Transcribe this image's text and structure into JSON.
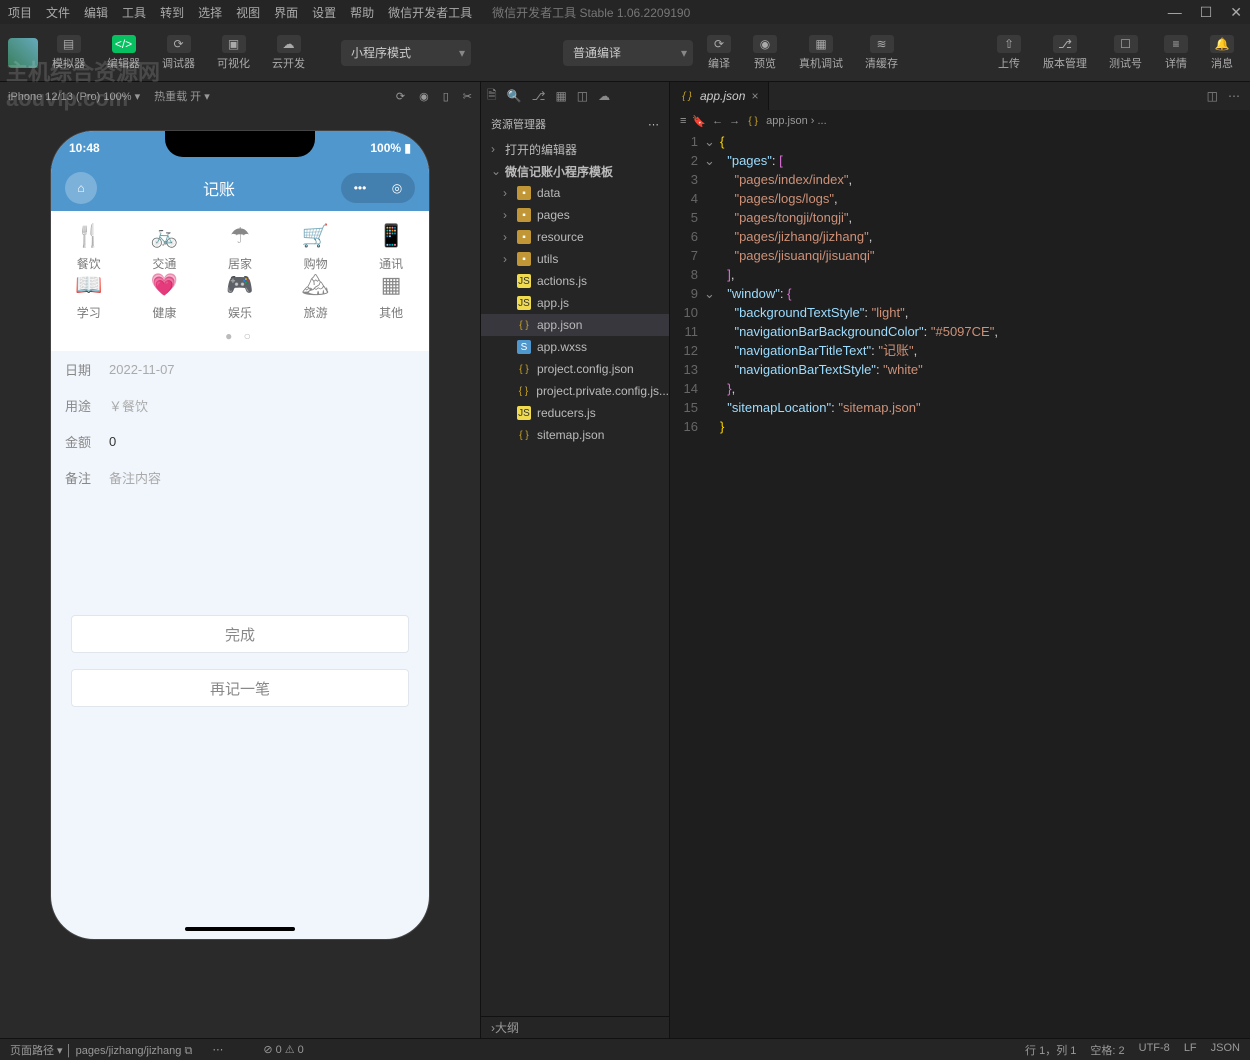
{
  "titlebar": {
    "menus": [
      "项目",
      "文件",
      "编辑",
      "工具",
      "转到",
      "选择",
      "视图",
      "界面",
      "设置",
      "帮助",
      "微信开发者工具"
    ],
    "app_title": "微信开发者工具 Stable 1.06.2209190"
  },
  "toolbar": {
    "buttons": [
      {
        "label": "模拟器",
        "id": "simulator-button"
      },
      {
        "label": "编辑器",
        "id": "editor-button"
      },
      {
        "label": "调试器",
        "id": "debugger-button"
      },
      {
        "label": "可视化",
        "id": "visual-button"
      },
      {
        "label": "云开发",
        "id": "cloud-button"
      }
    ],
    "mode": "小程序模式",
    "compile": "普通编译",
    "center": [
      {
        "label": "编译",
        "id": "compile-button"
      },
      {
        "label": "预览",
        "id": "preview-button"
      },
      {
        "label": "真机调试",
        "id": "remote-debug-button"
      },
      {
        "label": "清缓存",
        "id": "clear-cache-button"
      }
    ],
    "right": [
      {
        "label": "上传",
        "id": "upload-button"
      },
      {
        "label": "版本管理",
        "id": "version-button"
      },
      {
        "label": "测试号",
        "id": "test-button"
      },
      {
        "label": "详情",
        "id": "detail-button"
      },
      {
        "label": "消息",
        "id": "message-button"
      }
    ]
  },
  "simbar": {
    "device": "iPhone 12/13 (Pro)",
    "zoom": "100%",
    "hot": "热重载 开"
  },
  "phone": {
    "time": "10:48",
    "battery": "100%",
    "title": "记账",
    "cats": [
      "餐饮",
      "交通",
      "居家",
      "购物",
      "通讯",
      "学习",
      "健康",
      "娱乐",
      "旅游",
      "其他"
    ],
    "form": {
      "date_lbl": "日期",
      "date": "2022-11-07",
      "use_lbl": "用途",
      "use": "￥餐饮",
      "amt_lbl": "金额",
      "amt": "0",
      "note_lbl": "备注",
      "note": "备注内容"
    },
    "btn1": "完成",
    "btn2": "再记一笔"
  },
  "explorer": {
    "title": "资源管理器",
    "open_editors": "打开的编辑器",
    "project": "微信记账小程序模板",
    "folders": [
      "data",
      "pages",
      "resource",
      "utils"
    ],
    "files": [
      "actions.js",
      "app.js",
      "app.json",
      "app.wxss",
      "project.config.json",
      "project.private.config.js...",
      "reducers.js",
      "sitemap.json"
    ],
    "selected": "app.json",
    "outline": "大纲"
  },
  "editor": {
    "tab": "app.json",
    "crumb": "app.json › ...",
    "code": {
      "pages": [
        "pages/index/index",
        "pages/logs/logs",
        "pages/tongji/tongji",
        "pages/jizhang/jizhang",
        "pages/jisuanqi/jisuanqi"
      ],
      "window": {
        "backgroundTextStyle": "light",
        "navigationBarBackgroundColor": "#5097CE",
        "navigationBarTitleText": "记账",
        "navigationBarTextStyle": "white"
      },
      "sitemapLocation": "sitemap.json"
    }
  },
  "statusbar": {
    "path_lbl": "页面路径",
    "path": "pages/jizhang/jizhang",
    "problems": "⊘ 0 ⚠ 0",
    "pos": "行 1，列 1",
    "spaces": "空格: 2",
    "enc": "UTF-8",
    "eol": "LF",
    "lang": "JSON"
  },
  "watermark": [
    "主机综合资源网",
    "aouvip.com"
  ]
}
